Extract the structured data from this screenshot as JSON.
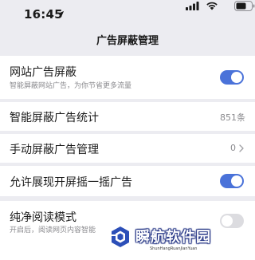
{
  "status_bar": {
    "time": "16:45",
    "icons": [
      "location-arrow-icon",
      "cellular-signal-icon",
      "wifi-icon",
      "battery-icon"
    ]
  },
  "nav": {
    "title": "广告屏蔽管理"
  },
  "settings": {
    "site_ad_block": {
      "title": "网站广告屏蔽",
      "subtitle": "智能屏蔽网站广告，为你节省更多流量",
      "enabled": true
    },
    "smart_block_stats": {
      "title": "智能屏蔽广告统计",
      "value": "851条"
    },
    "manual_block": {
      "title": "手动屏蔽广告管理",
      "value": "0"
    },
    "shake_ads": {
      "title": "允许展现开屏摇一摇广告",
      "enabled": true
    },
    "reader_mode": {
      "title": "纯净阅读模式",
      "subtitle": "开启后，阅读网页内容智能",
      "enabled": false
    }
  },
  "watermark": {
    "name": "瞬航软件园",
    "sub": "ShunHangRuanJianYuan"
  },
  "colors": {
    "accent": "#4a72d9",
    "background": "#ececf1",
    "card": "#ffffff"
  }
}
